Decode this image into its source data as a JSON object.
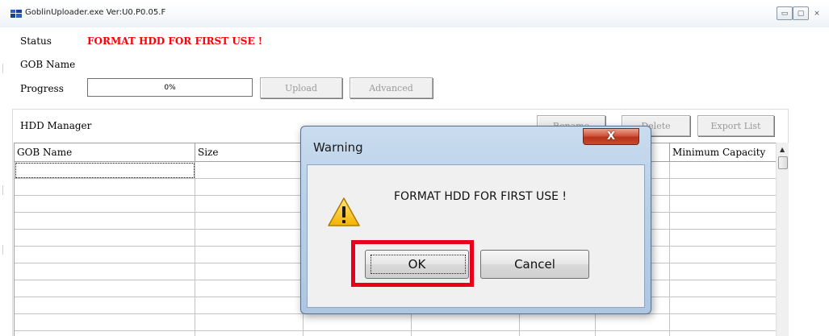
{
  "window": {
    "title": "GoblinUploader.exe Ver:U0.P0.05.F",
    "minimize_glyph": "▭",
    "maximize_glyph": "▢",
    "close_glyph": "⨯"
  },
  "status": {
    "label": "Status",
    "value": "FORMAT HDD FOR FIRST USE !",
    "value_color": "#ff0000"
  },
  "gob_name": {
    "label": "GOB Name",
    "value": ""
  },
  "progress": {
    "label": "Progress",
    "text": "0%",
    "percent": 0
  },
  "buttons": {
    "upload": "Upload",
    "advanced": "Advanced"
  },
  "hdd_manager": {
    "label": "HDD Manager",
    "rename": "Rename",
    "delete": "Delete",
    "export_list": "Export List",
    "columns": [
      "GOB Name",
      "Size",
      "",
      "",
      "",
      "",
      "Minimum Capacity"
    ]
  },
  "dialog": {
    "title": "Warning",
    "close_glyph": "X",
    "message": "FORMAT HDD FOR FIRST USE !",
    "icon": "warning-icon",
    "ok_label": "OK",
    "cancel_label": "Cancel",
    "highlight_color": "#e8001a"
  }
}
